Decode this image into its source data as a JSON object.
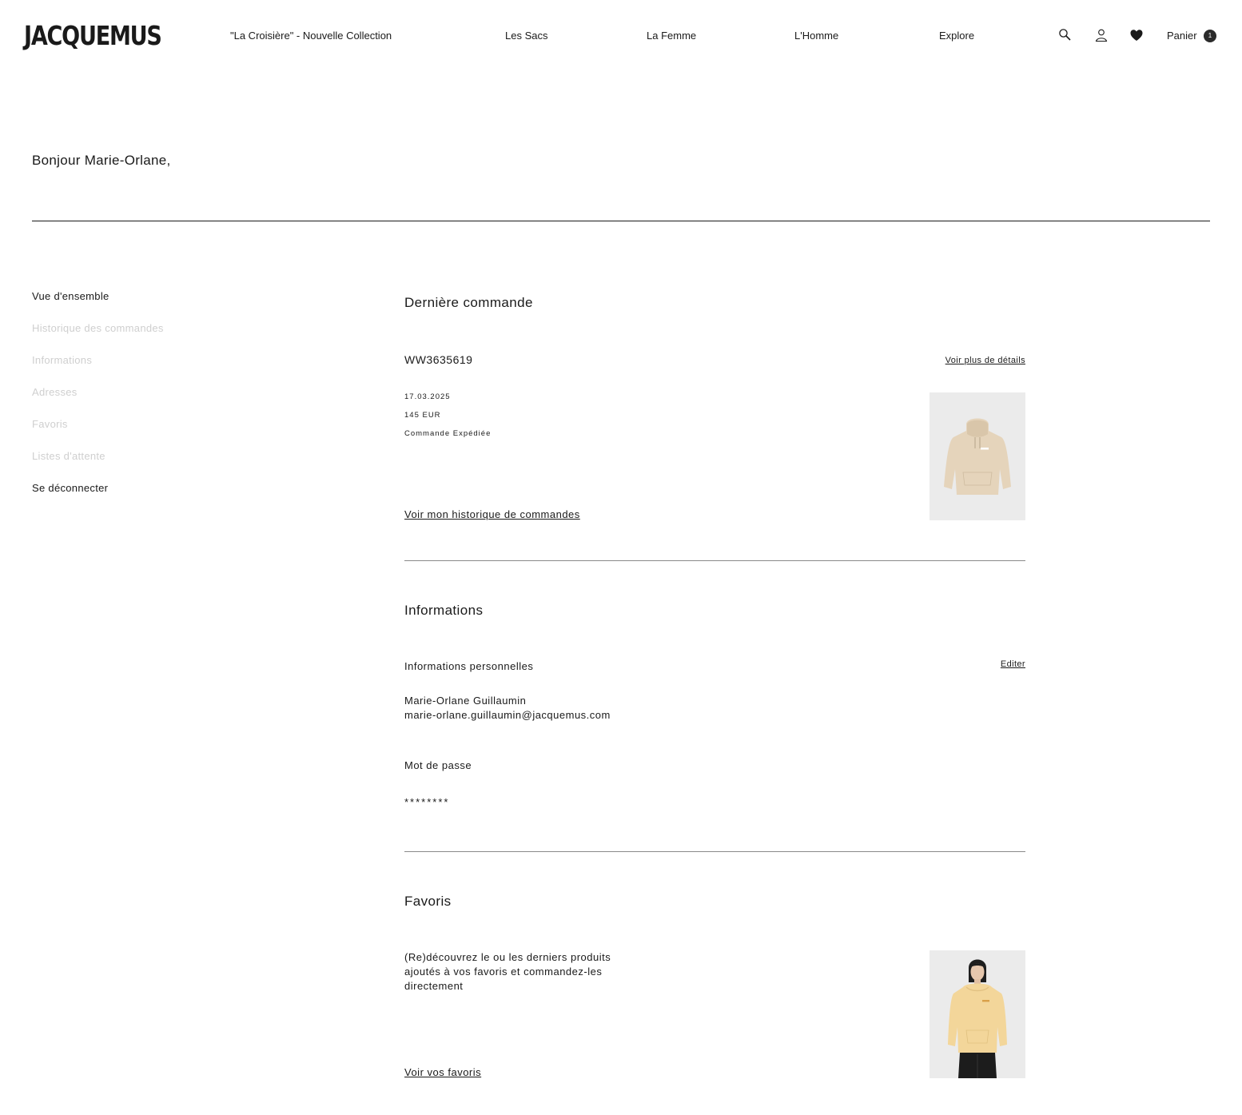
{
  "header": {
    "logo": "JACQUEMUS",
    "nav": [
      {
        "label": "\"La Croisière\" - Nouvelle Collection"
      },
      {
        "label": "Les Sacs"
      },
      {
        "label": "La Femme"
      },
      {
        "label": "L'Homme"
      },
      {
        "label": "Explore"
      }
    ],
    "icons": [
      "search-icon",
      "account-icon",
      "heart-icon"
    ],
    "cart_label": "Panier",
    "cart_count": "1"
  },
  "greeting": "Bonjour Marie-Orlane,",
  "sidebar": {
    "items": [
      {
        "label": "Vue d'ensemble"
      },
      {
        "label": "Historique des commandes"
      },
      {
        "label": "Informations"
      },
      {
        "label": "Adresses"
      },
      {
        "label": "Favoris"
      },
      {
        "label": "Listes d'attente"
      },
      {
        "label": "Se déconnecter"
      }
    ]
  },
  "last_order": {
    "title": "Dernière commande",
    "order_number": "WW3635619",
    "details_link": "Voir plus de détails",
    "date": "17.03.2025",
    "amount": "145 EUR",
    "status": "Commande Expédiée",
    "history_link": "Voir mon historique de commandes"
  },
  "informations": {
    "title": "Informations",
    "personal_label": "Informations personnelles",
    "edit_link": "Editer",
    "name": "Marie-Orlane Guillaumin",
    "email": "marie-orlane.guillaumin@jacquemus.com",
    "password_label": "Mot de passe",
    "password_value": "********"
  },
  "favoris": {
    "title": "Favoris",
    "description": "(Re)découvrez le ou les derniers produits ajoutés à vos favoris et commandez-les directement",
    "link": "Voir vos favoris"
  },
  "colors": {
    "text": "#1a1a1a",
    "muted": "#cfcfcf",
    "rule": "#8a8a8a",
    "hoodie_beige": "#e5d4bb",
    "hoodie_yellow": "#f3d69a"
  }
}
